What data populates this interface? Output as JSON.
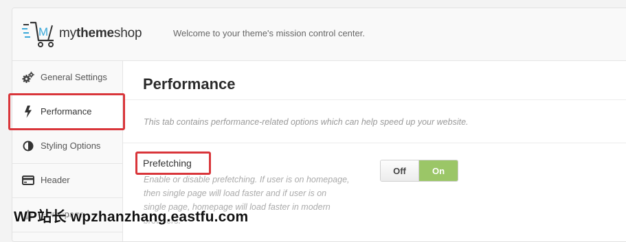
{
  "header": {
    "brand_light_1": "my",
    "brand_bold": "theme",
    "brand_light_2": "shop",
    "welcome": "Welcome to your theme's mission control center."
  },
  "sidebar": {
    "items": [
      {
        "label": "General Settings",
        "icon": "gears-icon"
      },
      {
        "label": "Performance",
        "icon": "lightning-bolt-icon",
        "active": true
      },
      {
        "label": "Styling Options",
        "icon": "contrast-icon"
      },
      {
        "label": "Header",
        "icon": "header-card-icon"
      },
      {
        "label": "Homepage",
        "icon": "home-icon"
      }
    ]
  },
  "main": {
    "title": "Performance",
    "description": "This tab contains performance-related options which can help speed up your website.",
    "option": {
      "title": "Prefetching",
      "help": "Enable or disable prefetching. If user is on homepage, then single page will load faster and if user is on single page, homepage will load faster in modern browsers.",
      "toggle_off": "Off",
      "toggle_on": "On",
      "value": "On"
    }
  },
  "watermark": "WP站长 wpzhanzhang.eastfu.com",
  "colors": {
    "highlight": "#d9353a",
    "toggle_on": "#9bc667",
    "logo_accent": "#3aa8d8"
  }
}
